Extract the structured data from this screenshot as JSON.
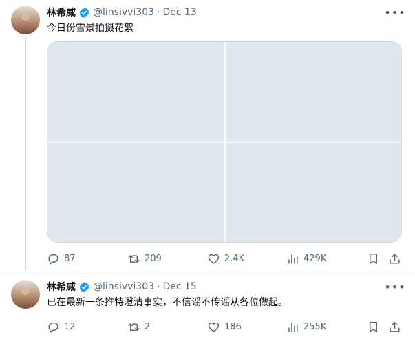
{
  "tweets": [
    {
      "author": {
        "name": "林希威",
        "handle": "@linsivvi303"
      },
      "separator": "·",
      "date": "Dec 13",
      "text": "今日份雪景拍摄花絮",
      "media_count": 4,
      "stats": {
        "replies": "87",
        "retweets": "209",
        "likes": "2.4K",
        "views": "429K"
      }
    },
    {
      "author": {
        "name": "林希威",
        "handle": "@linsivvi303"
      },
      "separator": "·",
      "date": "Dec 15",
      "text": "已在最新一条推特澄清事实，不信谣不传谣从各位做起。",
      "stats": {
        "replies": "12",
        "retweets": "2",
        "likes": "186",
        "views": "255K"
      }
    }
  ],
  "icons": {
    "verified": "verified-badge-icon",
    "more": "more-options-icon",
    "reply": "reply-icon",
    "retweet": "retweet-icon",
    "like": "heart-icon",
    "views": "analytics-icon",
    "bookmark": "bookmark-icon",
    "share": "share-icon"
  },
  "colors": {
    "verified": "#1d9bf0",
    "secondary_text": "#536471",
    "border": "#cfd9de"
  }
}
